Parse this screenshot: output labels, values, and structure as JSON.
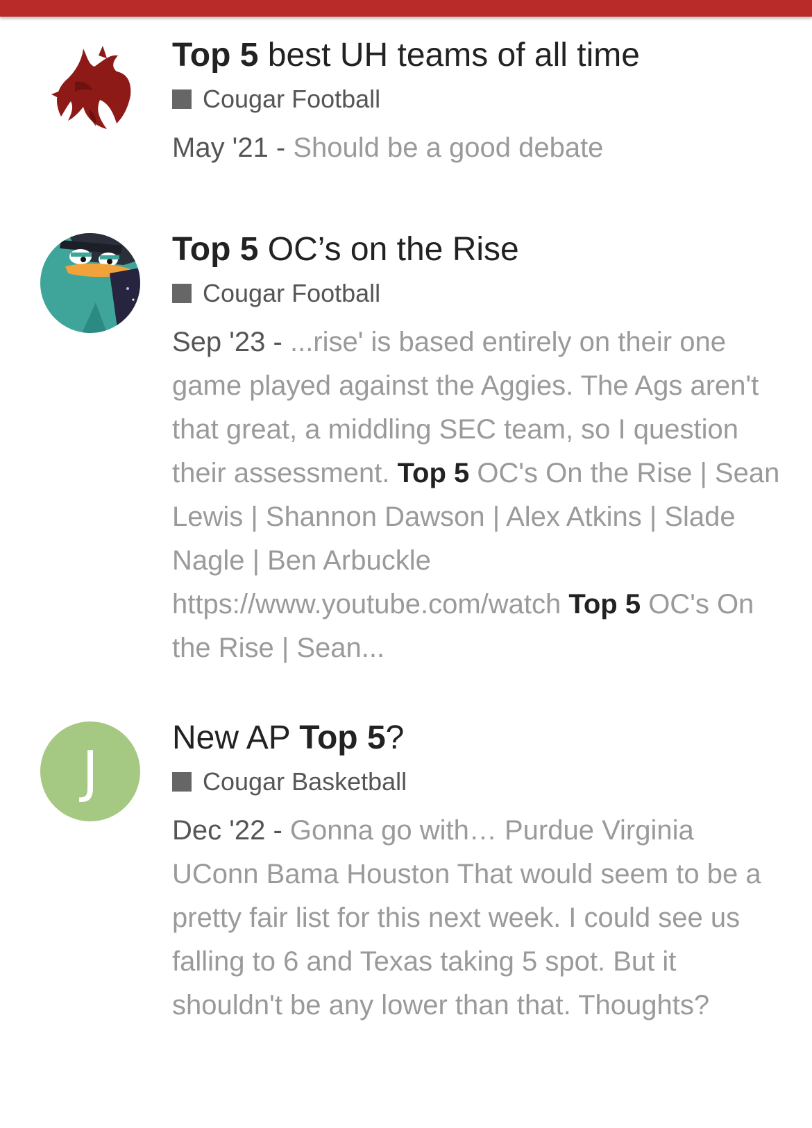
{
  "colors": {
    "topbar": "#b82b28",
    "title_text": "#222222",
    "category_square": "#666666",
    "blurb_text": "#9a9a9a",
    "avatar_j_bg": "#a5c882"
  },
  "results": [
    {
      "avatar_icon": "red-dragon-avatar-icon",
      "title_bold": "Top 5",
      "title_after": " best UH teams of all time",
      "category": "Cougar Football",
      "date": "May '21 - ",
      "blurb": "Should be a good debate"
    },
    {
      "avatar_icon": "platypus-agent-avatar-icon",
      "title_bold": "Top 5",
      "title_after": " OC’s on the Rise",
      "category": "Cougar Football",
      "date": "Sep '23 - ",
      "blurb_part1": "...rise' is based entirely on their one game played against the Aggies. The Ags aren't that great, a middling SEC team, so I question their assessment. ",
      "blurb_bold1": "Top 5",
      "blurb_part2": " OC's On the Rise | Sean Lewis | Shannon Dawson | Alex Atkins | Slade Nagle | Ben Arbuckle https://www.youtube.com/watch ",
      "blurb_bold2": "Top 5",
      "blurb_part3": " OC's On the Rise | Sean..."
    },
    {
      "avatar_letter": "J",
      "title_before": "New AP ",
      "title_bold": "Top 5",
      "title_after": "?",
      "category": "Cougar Basketball",
      "date": "Dec '22 - ",
      "blurb": "Gonna go with… Purdue Virginia UConn Bama Houston That would seem to be a pretty fair list for this next week. I could see us falling to 6 and Texas taking 5 spot. But it shouldn't be any lower than that. Thoughts?"
    }
  ]
}
